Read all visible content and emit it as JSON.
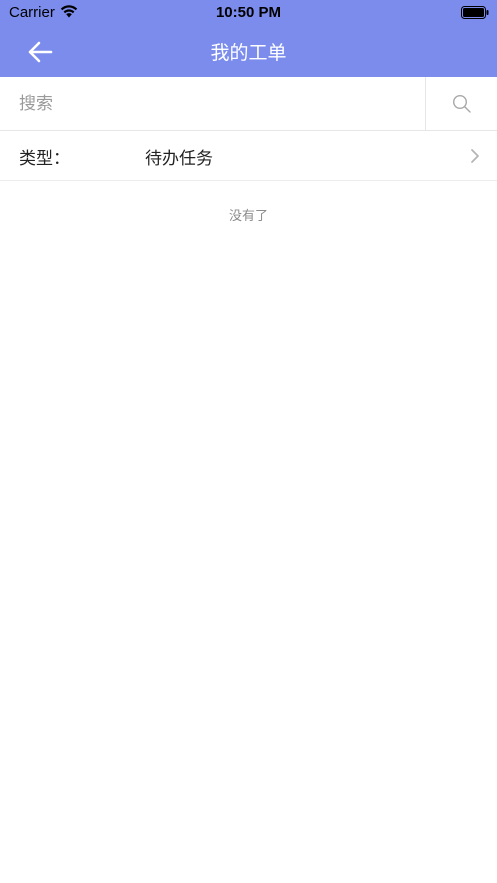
{
  "status_bar": {
    "carrier": "Carrier",
    "time": "10:50 PM",
    "wifi_icon": "wifi-icon",
    "battery_icon": "battery-icon"
  },
  "nav": {
    "title": "我的工单",
    "back_icon": "arrow-left-icon",
    "background_color": "#7b8ced"
  },
  "search": {
    "placeholder": "搜索",
    "value": "",
    "icon": "search-icon"
  },
  "filter": {
    "label": "类型：",
    "value": "待办任务",
    "icon": "chevron-right-icon"
  },
  "list": {
    "empty_message": "没有了"
  }
}
